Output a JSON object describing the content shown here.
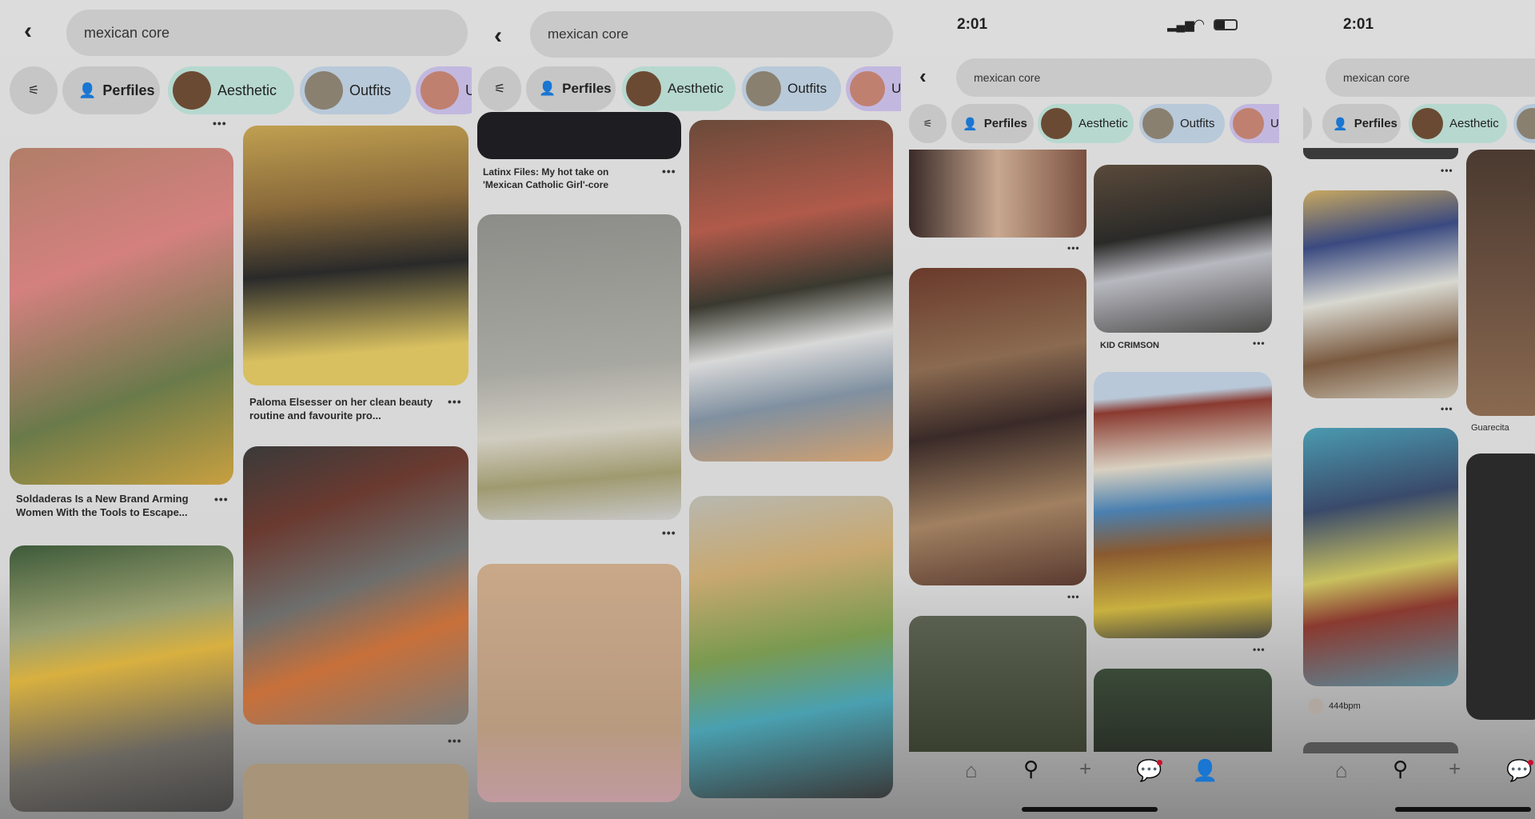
{
  "search": {
    "query": "mexican core"
  },
  "chips": {
    "perfiles": "Perfiles",
    "aesthetic": "Aesthetic",
    "outfits": "Outfits",
    "partial": "U"
  },
  "status": {
    "time": "2:01"
  },
  "captions": {
    "soldaderas": "Soldaderas Is a New Brand Arming Women With the Tools to Escape...",
    "paloma": "Paloma Elsesser on her clean beauty routine and favourite pro...",
    "latinx": "Latinx Files: My hot take on 'Mexican Catholic Girl'-core",
    "kid_crimson": "KID CRIMSON",
    "guarecita": "Guarecita",
    "user_444": "444bpm"
  },
  "more_label": "•••",
  "icons": {
    "back": "chevron-left",
    "filter": "sliders",
    "person": "person",
    "home": "home",
    "search": "magnifier",
    "add": "plus",
    "messages": "chat-bubble",
    "profile": "person"
  },
  "colors": {
    "notification": "#c8102e",
    "chip_aesthetic": "#b6d8cf",
    "chip_outfits": "#b8c9d9",
    "chip_partial": "#c2b8df"
  }
}
